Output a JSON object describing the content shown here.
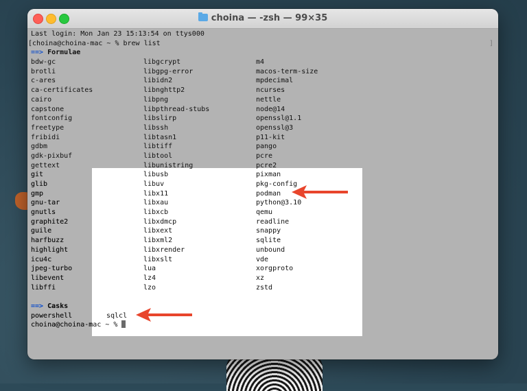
{
  "window": {
    "title": "choina — -zsh — 99×35"
  },
  "terminal": {
    "login_line": "Last login: Mon Jan 23 15:13:54 on ttys000",
    "prompt_line": "choina@choina-mac ~ % brew list",
    "prompt_bracket_open": "[",
    "prompt_bracket_close": "]",
    "formulae_arrow": "==>",
    "formulae_header": "Formulae",
    "formulae_rows": [
      [
        "bdw-gc",
        "libgcrypt",
        "m4"
      ],
      [
        "brotli",
        "libgpg-error",
        "macos-term-size"
      ],
      [
        "c-ares",
        "libidn2",
        "mpdecimal"
      ],
      [
        "ca-certificates",
        "libnghttp2",
        "ncurses"
      ],
      [
        "cairo",
        "libpng",
        "nettle"
      ],
      [
        "capstone",
        "libpthread-stubs",
        "node@14"
      ],
      [
        "fontconfig",
        "libslirp",
        "openssl@1.1"
      ],
      [
        "freetype",
        "libssh",
        "openssl@3"
      ],
      [
        "fribidi",
        "libtasn1",
        "p11-kit"
      ],
      [
        "gdbm",
        "libtiff",
        "pango"
      ],
      [
        "gdk-pixbuf",
        "libtool",
        "pcre"
      ],
      [
        "gettext",
        "libunistring",
        "pcre2"
      ],
      [
        "git",
        "libusb",
        "pixman"
      ],
      [
        "glib",
        "libuv",
        "pkg-config"
      ],
      [
        "gmp",
        "libx11",
        "podman"
      ],
      [
        "gnu-tar",
        "libxau",
        "python@3.10"
      ],
      [
        "gnutls",
        "libxcb",
        "qemu"
      ],
      [
        "graphite2",
        "libxdmcp",
        "readline"
      ],
      [
        "guile",
        "libxext",
        "snappy"
      ],
      [
        "harfbuzz",
        "libxml2",
        "sqlite"
      ],
      [
        "highlight",
        "libxrender",
        "unbound"
      ],
      [
        "icu4c",
        "libxslt",
        "vde"
      ],
      [
        "jpeg-turbo",
        "lua",
        "xorgproto"
      ],
      [
        "libevent",
        "lz4",
        "xz"
      ],
      [
        "libffi",
        "lzo",
        "zstd"
      ]
    ],
    "casks_arrow": "==>",
    "casks_header": "Casks",
    "casks": [
      "powershell",
      "sqlcl"
    ],
    "final_prompt": "choina@choina-mac ~ % "
  },
  "annotations": {
    "arrow_color": "#e8452c"
  }
}
